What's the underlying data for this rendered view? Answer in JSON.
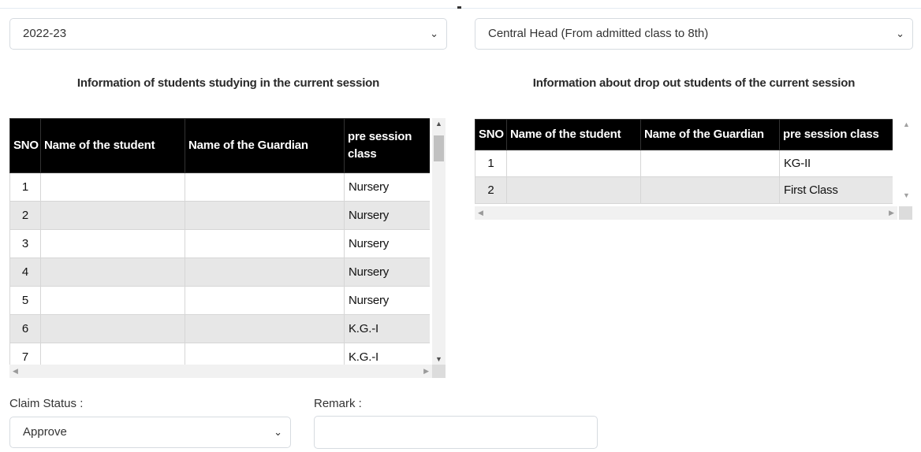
{
  "filters": {
    "session_year": "2022-23",
    "head": "Central Head (From admitted class to 8th)"
  },
  "current_session": {
    "heading": "Information of students studying in the current session",
    "columns": [
      "SNO",
      "Name of the student",
      "Name of the Guardian",
      "pre session class"
    ],
    "rows": [
      {
        "sno": "1",
        "student": "",
        "guardian": "",
        "pre_class": "Nursery"
      },
      {
        "sno": "2",
        "student": "",
        "guardian": "",
        "pre_class": "Nursery"
      },
      {
        "sno": "3",
        "student": "",
        "guardian": "",
        "pre_class": "Nursery"
      },
      {
        "sno": "4",
        "student": "",
        "guardian": "",
        "pre_class": "Nursery"
      },
      {
        "sno": "5",
        "student": "",
        "guardian": "",
        "pre_class": "Nursery"
      },
      {
        "sno": "6",
        "student": "",
        "guardian": "",
        "pre_class": "K.G.-I"
      },
      {
        "sno": "7",
        "student": "",
        "guardian": "",
        "pre_class": "K.G.-I"
      }
    ]
  },
  "dropout": {
    "heading": "Information about drop out students of the current session",
    "columns": [
      "SNO",
      "Name of the student",
      "Name of the Guardian",
      "pre session class"
    ],
    "rows": [
      {
        "sno": "1",
        "student": "",
        "guardian": "",
        "pre_class": "KG-II"
      },
      {
        "sno": "2",
        "student": "",
        "guardian": "",
        "pre_class": "First Class"
      }
    ]
  },
  "claim": {
    "label": "Claim Status :",
    "value": "Approve"
  },
  "remark": {
    "label": "Remark :",
    "value": ""
  },
  "icons": {
    "dropdown": "chevron-down-icon",
    "scroll_up": "triangle-up-icon",
    "scroll_down": "triangle-down-icon",
    "scroll_left": "triangle-left-icon",
    "scroll_right": "triangle-right-icon"
  }
}
